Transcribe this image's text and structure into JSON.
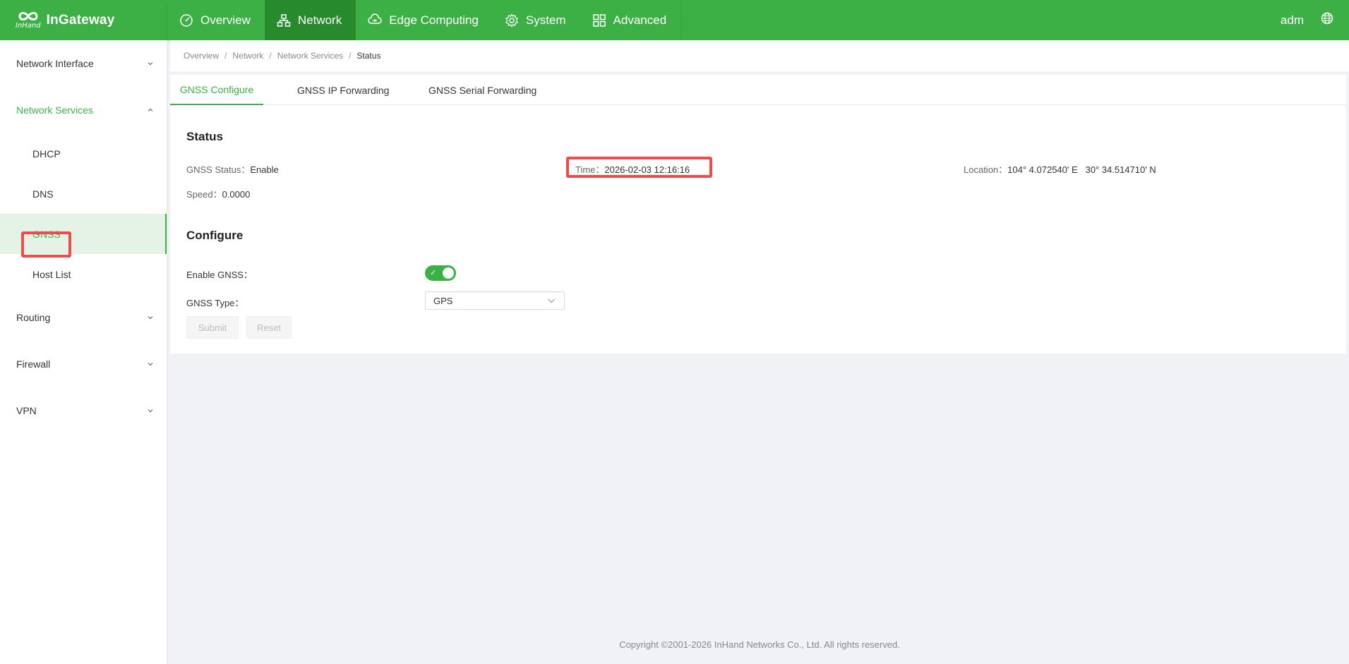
{
  "brand": {
    "name": "InGateway",
    "sub": "InHand"
  },
  "nav": {
    "items": [
      {
        "label": "Overview",
        "icon": "dashboard-icon"
      },
      {
        "label": "Network",
        "icon": "network-icon"
      },
      {
        "label": "Edge Computing",
        "icon": "edge-computing-icon"
      },
      {
        "label": "System",
        "icon": "gear-icon"
      },
      {
        "label": "Advanced",
        "icon": "grid-icon"
      }
    ],
    "active": "Network"
  },
  "user": {
    "name": "adm",
    "language_icon": "globe-icon"
  },
  "sidebar": {
    "network_interface": "Network Interface",
    "network_services": "Network Services",
    "sub_items": [
      "DHCP",
      "DNS",
      "GNSS",
      "Host List"
    ],
    "active_sub": "GNSS",
    "routing": "Routing",
    "firewall": "Firewall",
    "vpn": "VPN"
  },
  "breadcrumb": {
    "items": [
      "Overview",
      "Network",
      "Network Services",
      "Status"
    ],
    "separator": "/"
  },
  "tabs": {
    "items": [
      "GNSS Configure",
      "GNSS IP Forwarding",
      "GNSS Serial Forwarding"
    ],
    "active": "GNSS Configure"
  },
  "status": {
    "title": "Status",
    "gnss_status_label": "GNSS Status：",
    "gnss_status_value": "Enable",
    "time_label": "Time：",
    "time_value": "2026-02-03 12:16:16",
    "location_label": "Location：",
    "location_value": "104° 4.072540' E   30° 34.514710' N",
    "speed_label": "Speed：",
    "speed_value": "0.0000"
  },
  "configure": {
    "title": "Configure",
    "enable_label": "Enable GNSS：",
    "enable_value": true,
    "type_label": "GNSS Type：",
    "type_value": "GPS",
    "submit_label": "Submit",
    "reset_label": "Reset"
  },
  "colors": {
    "brand_green": "#3db045",
    "active_nav": "#278a2d",
    "highlight": "#f04b4b"
  },
  "footer": {
    "copyright": "Copyright ©2001-2026 InHand Networks Co., Ltd. All rights reserved."
  }
}
